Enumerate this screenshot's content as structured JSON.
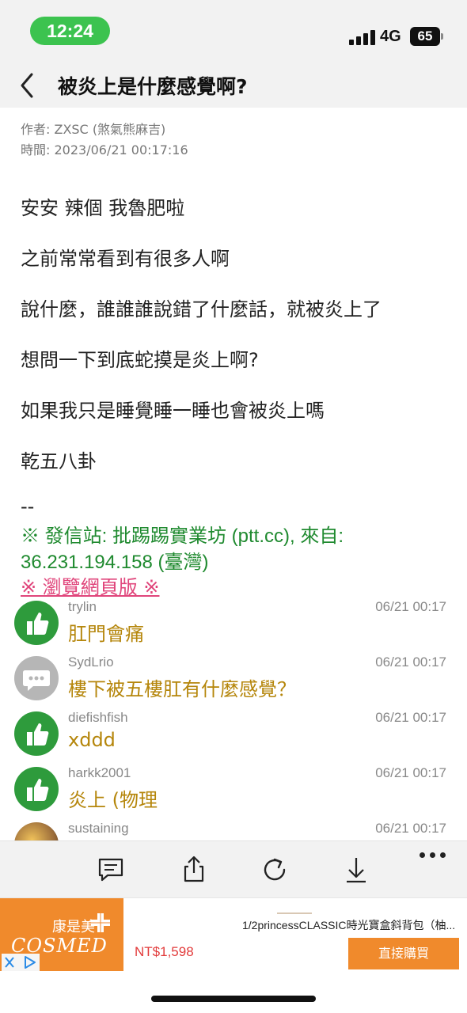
{
  "status_bar": {
    "time": "12:24",
    "network": "4G",
    "battery": "65"
  },
  "nav": {
    "title": "被炎上是什麼感覺啊?"
  },
  "meta": {
    "author": "作者: ZXSC (煞氣熊麻吉)",
    "time": "時間: 2023/06/21 00:17:16"
  },
  "article": {
    "lines": [
      "安安 辣個 我魯肥啦",
      "之前常常看到有很多人啊",
      "說什麼，誰誰誰說錯了什麼話，就被炎上了",
      "想問一下到底蛇摸是炎上啊?",
      "如果我只是睡覺睡一睡也會被炎上嗎",
      "乾五八卦"
    ],
    "signature_dash": "--",
    "signature_line1": "※ 發信站: 批踢踢實業坊 (ptt.cc), 來自:",
    "signature_line2": "36.231.194.158 (臺灣)",
    "web_link": "※ 瀏覽網頁版 ※"
  },
  "comments": [
    {
      "user": "trylin",
      "time": "06/21 00:17",
      "text": "肛門會痛",
      "type": "push"
    },
    {
      "user": "SydLrio",
      "time": "06/21 00:17",
      "text": "樓下被五樓肛有什麼感覺？",
      "type": "arrow"
    },
    {
      "user": "diefishfish",
      "time": "06/21 00:17",
      "text": "xddd",
      "type": "push"
    },
    {
      "user": "harkk2001",
      "time": "06/21 00:17",
      "text": "炎上 (物理",
      "type": "push"
    },
    {
      "user": "sustaining",
      "time": "06/21 00:17",
      "text": "",
      "type": "photo"
    }
  ],
  "toolbar": {
    "icons": [
      "comment-icon",
      "share-icon",
      "refresh-icon",
      "download-icon",
      "more-icon"
    ]
  },
  "ad": {
    "brand_cn": "康是美",
    "brand_en": "COSMED",
    "title": "1/2princessCLASSIC時光寶盒斜背包（柚...",
    "price": "NT$1,598",
    "buy_label": "直接購買",
    "brand_color": "#f08a2c"
  },
  "colors": {
    "push_green": "#2e9b3c",
    "comment_text": "#b5860b",
    "signature_green": "#1f8a2f",
    "link_pink": "#e0457b",
    "clock_green": "#3cc34f"
  }
}
